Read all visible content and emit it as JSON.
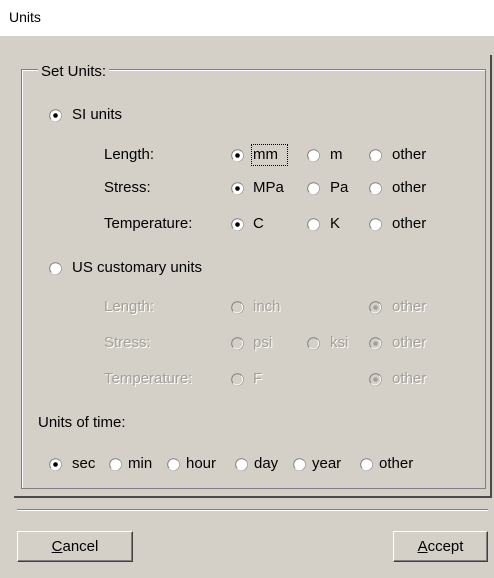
{
  "window": {
    "title": "Units"
  },
  "group": {
    "title": "Set Units:"
  },
  "si": {
    "label": "SI units",
    "selected": true,
    "rows": [
      {
        "label": "Length:",
        "options": [
          "mm",
          "m",
          "other"
        ],
        "selected": 0
      },
      {
        "label": "Stress:",
        "options": [
          "MPa",
          "Pa",
          "other"
        ],
        "selected": 0
      },
      {
        "label": "Temperature:",
        "options": [
          "C",
          "K",
          "other"
        ],
        "selected": 0
      }
    ]
  },
  "us": {
    "label": "US customary units",
    "selected": false,
    "rows": [
      {
        "label": "Length:",
        "options": [
          "inch",
          "other"
        ],
        "selected": 1
      },
      {
        "label": "Stress:",
        "options": [
          "psi",
          "ksi",
          "other"
        ],
        "selected": 2
      },
      {
        "label": "Temperature:",
        "options": [
          "F",
          "other"
        ],
        "selected": 1
      }
    ]
  },
  "time": {
    "label": "Units of time:",
    "options": [
      "sec",
      "min",
      "hour",
      "day",
      "year",
      "other"
    ],
    "selected": 0
  },
  "buttons": {
    "cancel_first": "C",
    "cancel_rest": "ancel",
    "accept_first": "A",
    "accept_rest": "ccept"
  },
  "colors": {
    "background": "#d4d0c8",
    "disabled_text": "#a3a099"
  }
}
